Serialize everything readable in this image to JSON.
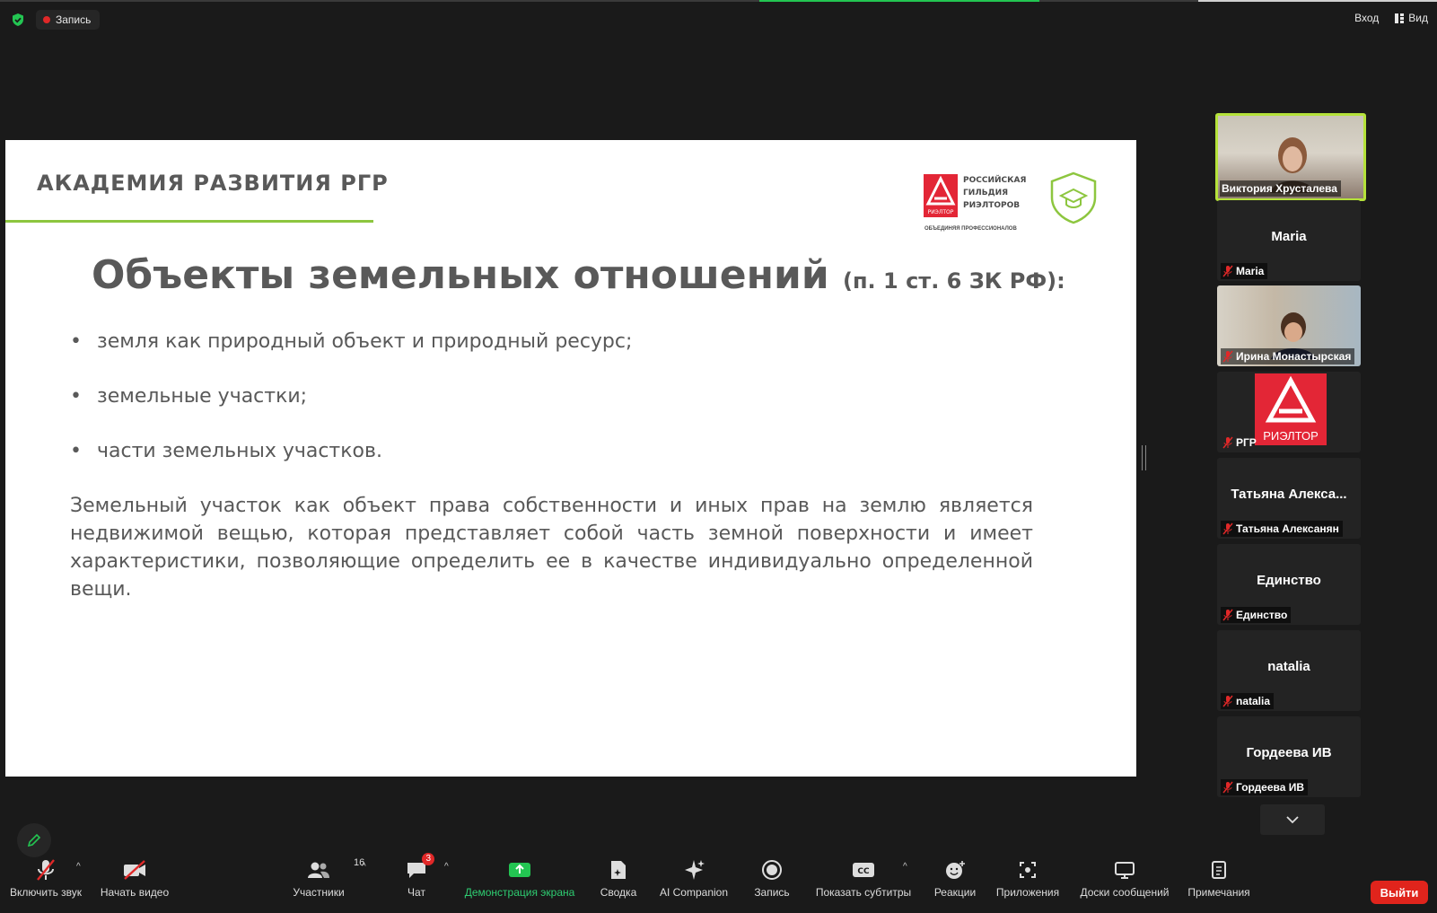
{
  "topbar": {
    "recording_label": "Запись",
    "signin_label": "Вход",
    "view_label": "Вид"
  },
  "slide": {
    "academy_title": "АКАДЕМИЯ РАЗВИТИЯ РГР",
    "logo_lines": [
      "РОССИЙСКАЯ",
      "ГИЛЬДИЯ",
      "РИЭЛТОРОВ"
    ],
    "logo_mark_text": "РИЭЛТОР",
    "logo_sub": "ОБЪЕДИНЯЯ ПРОФЕССИОНАЛОВ",
    "title_main": "Объекты земельных отношений",
    "title_ref": "(п. 1 ст. 6 ЗК РФ):",
    "bullets": [
      "земля как природный объект и природный ресурс;",
      "земельные участки;",
      "части земельных участков."
    ],
    "paragraph": "Земельный участок как объект права собственности и иных прав на землю является недвижимой вещью, которая представляет собой часть земной поверхности и имеет характеристики, позволяющие определить ее в качестве индивидуально определенной вещи."
  },
  "participants": [
    {
      "name": "Виктория Хрусталева",
      "type": "video",
      "active": true
    },
    {
      "name": "Maria",
      "center": "Maria",
      "type": "name",
      "muted": true
    },
    {
      "name": "Ирина Монастырская",
      "type": "video",
      "muted": true
    },
    {
      "name": "РГР",
      "type": "logo",
      "logo_text": "РИЭЛТОР",
      "muted": true
    },
    {
      "name": "Татьяна Алексанян",
      "center": "Татьяна  Алекса...",
      "type": "name",
      "muted": true
    },
    {
      "name": "Единство",
      "center": "Единство",
      "type": "name",
      "muted": true
    },
    {
      "name": "natalia",
      "center": "natalia",
      "type": "name",
      "muted": true
    },
    {
      "name": "Гордеева ИВ",
      "center": "Гордеева ИВ",
      "type": "name",
      "muted": true
    }
  ],
  "toolbar": {
    "unmute": "Включить звук",
    "start_video": "Начать видео",
    "participants": "Участники",
    "participants_count": "16",
    "chat": "Чат",
    "chat_badge": "3",
    "share": "Демонстрация экрана",
    "summary": "Сводка",
    "ai": "AI Companion",
    "record": "Запись",
    "captions": "Показать субтитры",
    "reactions": "Реакции",
    "apps": "Приложения",
    "whiteboards": "Доски сообщений",
    "notes": "Примечания",
    "leave": "Выйти"
  },
  "colors": {
    "accent_green": "#8dc63f",
    "brand_red": "#e32636",
    "share_green": "#2ecc71",
    "leave_red": "#e0241c"
  }
}
